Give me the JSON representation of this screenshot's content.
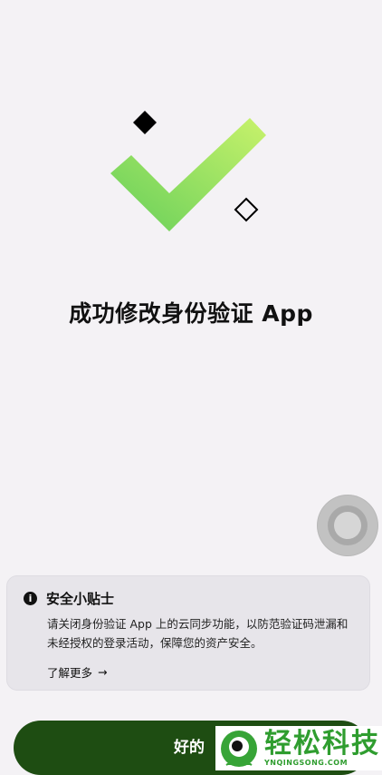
{
  "screen": {
    "title": "成功修改身份验证 App"
  },
  "illustration": {
    "icon": "checkmark-with-diamonds",
    "check_color_light": "#c6f06a",
    "check_color_dark": "#6fd35a"
  },
  "tips": {
    "title": "安全小贴士",
    "body": "请关闭身份验证 App 上的云同步功能，以防范验证码泄漏和未经授权的登录活动，保障您的资产安全。",
    "link_label": "了解更多",
    "link_arrow": "→"
  },
  "primary_button": {
    "label": "好的",
    "color": "#1e4d12"
  },
  "watermark": {
    "brand": "轻松科技",
    "domain": "YNQINGSONG.COM"
  }
}
